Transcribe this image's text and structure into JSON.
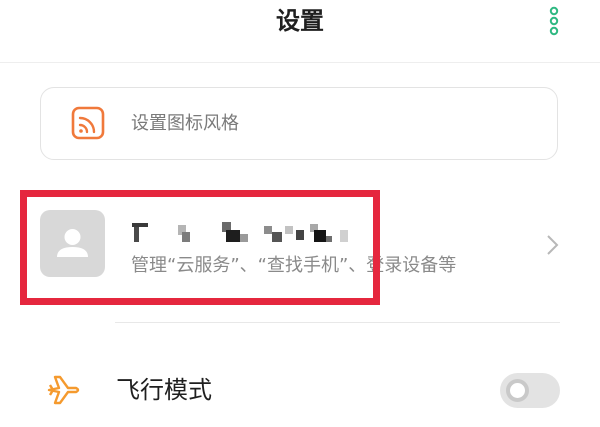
{
  "header": {
    "title": "设置",
    "menu_icon": "more-vertical-icon",
    "accent_color": "#2fb982"
  },
  "icon_style_card": {
    "label": "设置图标风格",
    "icon": "icon-style-icon",
    "icon_color": "#f0793b"
  },
  "account": {
    "avatar_icon": "person-icon",
    "subtitle": "管理“云服务”、“查找手机”、登录设备等",
    "chevron_icon": "chevron-right-icon"
  },
  "highlight": {
    "color": "#e5273e"
  },
  "settings": [
    {
      "label": "飞行模式",
      "icon": "airplane-icon",
      "icon_color": "#f59a2e",
      "enabled": false
    }
  ]
}
